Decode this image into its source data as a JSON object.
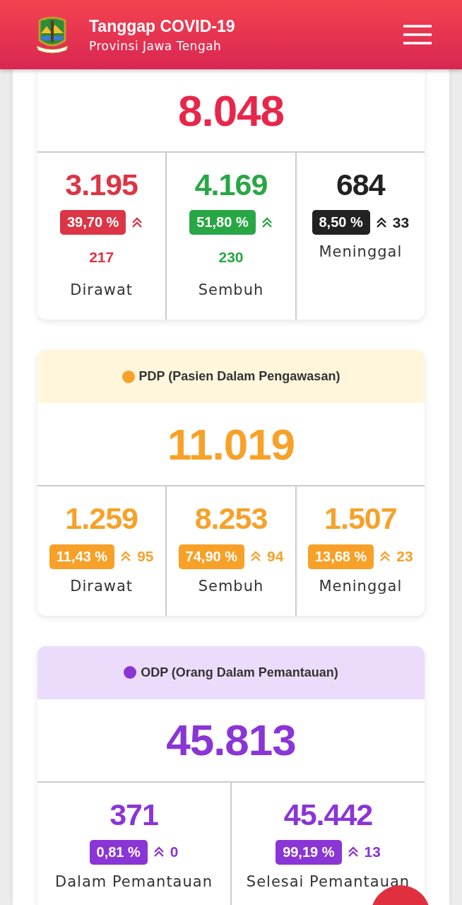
{
  "header": {
    "title": "Tanggap COVID-19",
    "subtitle": "Provinsi Jawa Tengah"
  },
  "sections": [
    {
      "total": "8.048",
      "color": "#e8264a",
      "stats": [
        {
          "kind": "stacked",
          "value": "3.195",
          "percent": "39,70 %",
          "delta": "217",
          "label": "Dirawat",
          "color": "#dc3545"
        },
        {
          "kind": "stacked",
          "value": "4.169",
          "percent": "51,80 %",
          "delta": "230",
          "label": "Sembuh",
          "color": "#28a745"
        },
        {
          "kind": "inline",
          "value": "684",
          "percent": "8,50 %",
          "delta": "33",
          "label": "Meninggal",
          "color": "#222222"
        }
      ]
    },
    {
      "title": "PDP (Pasien Dalam Pengawasan)",
      "color": "#f7a128",
      "stats": [
        {
          "kind": "inline",
          "value": "1.259",
          "percent": "11,43 %",
          "delta": "95",
          "label": "Dirawat",
          "color": "#f7a128"
        },
        {
          "kind": "inline",
          "value": "8.253",
          "percent": "74,90 %",
          "delta": "94",
          "label": "Sembuh",
          "color": "#f7a128"
        },
        {
          "kind": "inline",
          "value": "1.507",
          "percent": "13,68 %",
          "delta": "23",
          "label": "Meninggal",
          "color": "#f7a128"
        }
      ],
      "total": "11.019"
    },
    {
      "title": "ODP (Orang Dalam Pemantauan)",
      "color": "#8a35d6",
      "stats": [
        {
          "kind": "inline",
          "value": "371",
          "percent": "0,81 %",
          "delta": "0",
          "label": "Dalam Pemantauan",
          "color": "#8a35d6"
        },
        {
          "kind": "inline",
          "value": "45.442",
          "percent": "99,19 %",
          "delta": "13",
          "label": "Selesai Pemantauan",
          "color": "#8a35d6"
        }
      ],
      "total": "45.813"
    }
  ]
}
